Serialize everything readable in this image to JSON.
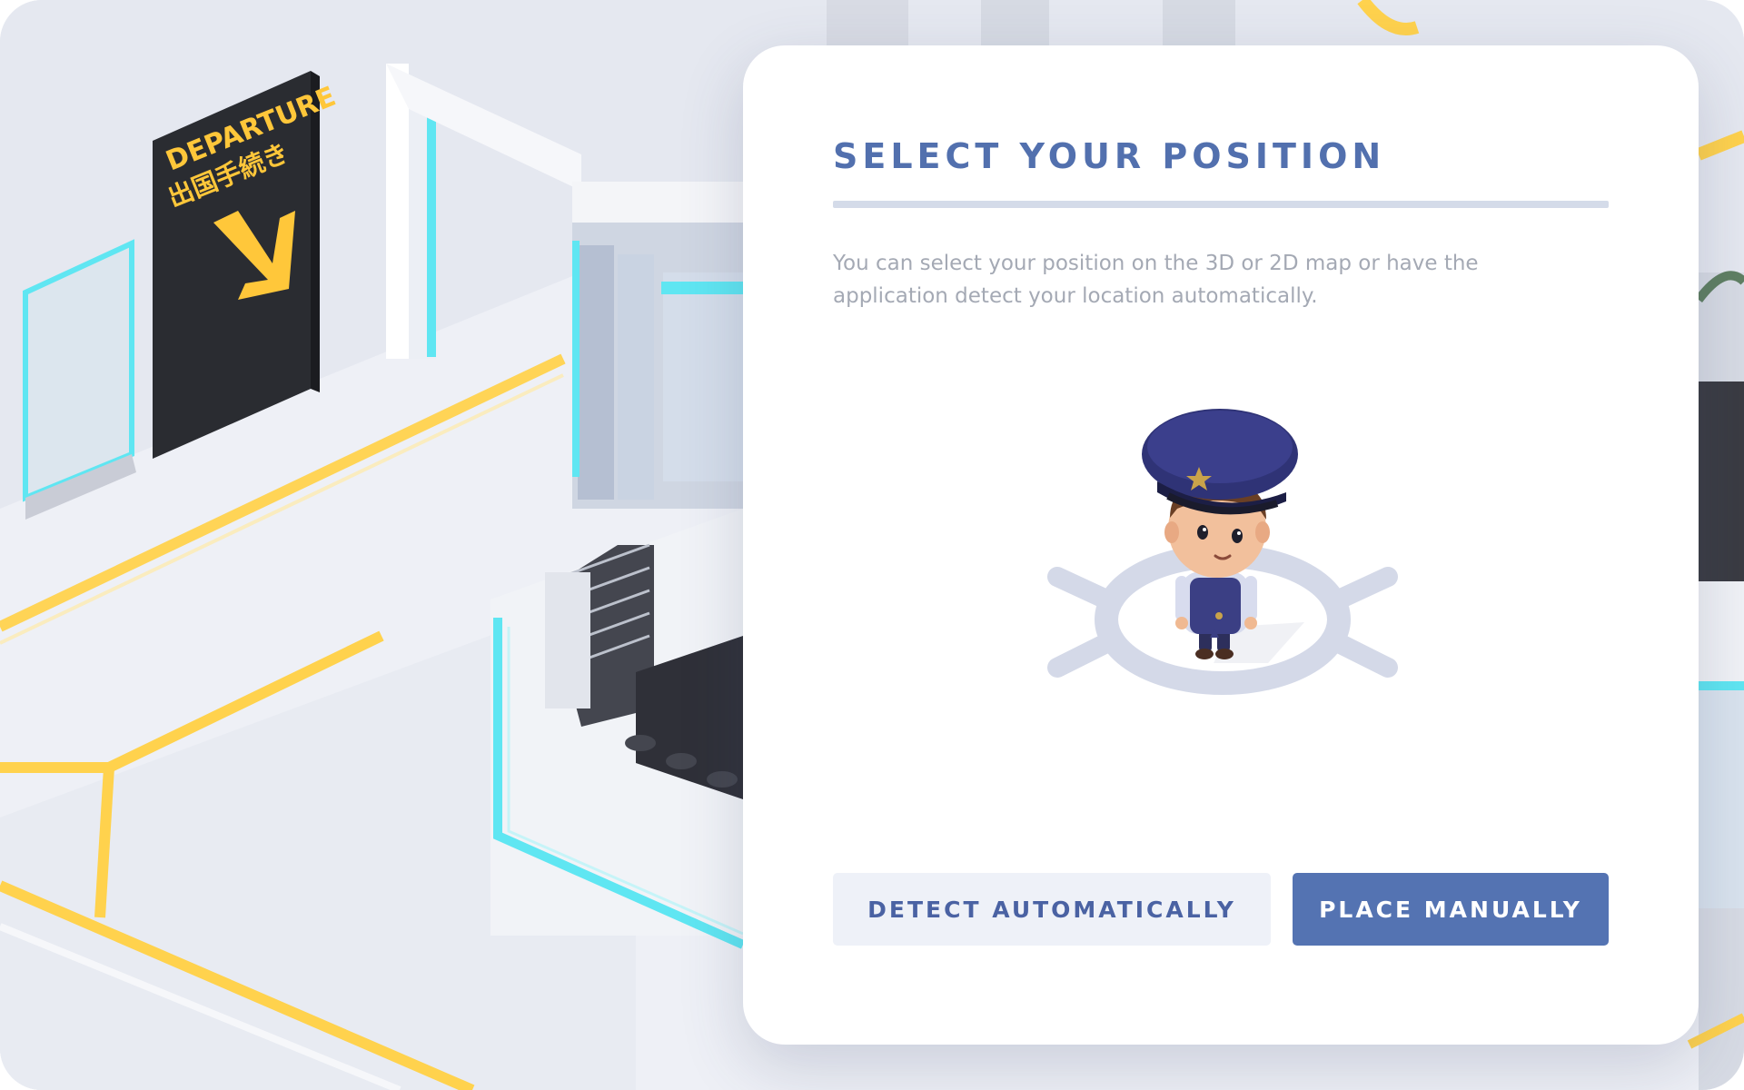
{
  "modal": {
    "title": "SELECT YOUR POSITION",
    "description": "You can select your position on the 3D or 2D map or have the application detect your location automatically.",
    "buttons": {
      "detect_label": "DETECT AUTOMATICALLY",
      "manual_label": "PLACE MANUALLY"
    }
  },
  "background": {
    "sign_text_en": "DEPARTURE",
    "sign_text_jp": "出国手続き",
    "sign_icon": "arrow-down-right-icon"
  },
  "illustration": {
    "character": "security-guard-avatar",
    "marker_icon": "position-target-icon"
  },
  "colors": {
    "accent": "#5473b2",
    "title": "#5270ae",
    "secondary_button_bg": "#eef1f8",
    "neon_yellow": "#ffd24d",
    "neon_cyan": "#5fe6f2",
    "sign_bg": "#2a2c31"
  }
}
